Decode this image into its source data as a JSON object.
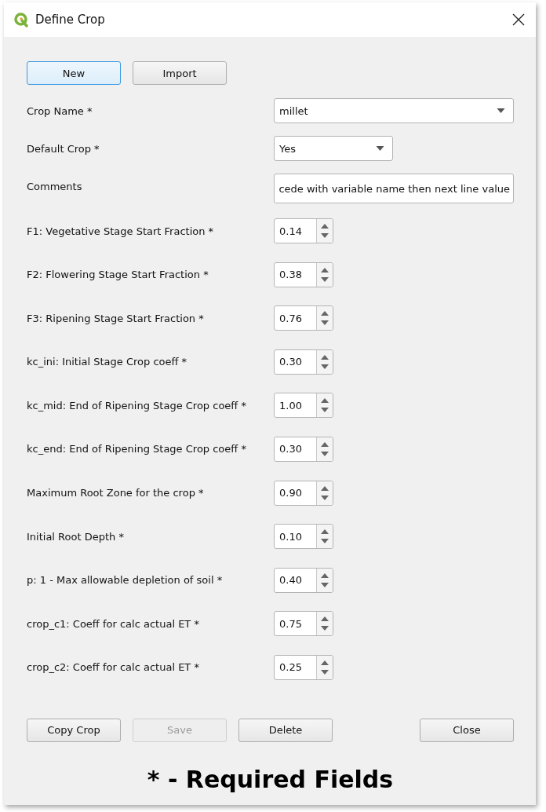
{
  "window": {
    "title": "Define Crop"
  },
  "top_buttons": [
    {
      "label": "New",
      "focused": true,
      "disabled": false
    },
    {
      "label": "Import",
      "focused": false,
      "disabled": false
    }
  ],
  "fields": [
    {
      "kind": "dropdown",
      "label": "Crop Name *",
      "value": "millet",
      "wide": true
    },
    {
      "kind": "dropdown",
      "label": "Default Crop *",
      "value": "Yes",
      "wide": false
    },
    {
      "kind": "text",
      "label": "Comments",
      "value": "cede with variable name then next line value"
    },
    {
      "kind": "spin",
      "label": "F1: Vegetative Stage Start Fraction *",
      "value": "0.14"
    },
    {
      "kind": "spin",
      "label": "F2: Flowering Stage Start Fraction *",
      "value": "0.38"
    },
    {
      "kind": "spin",
      "label": "F3: Ripening Stage Start Fraction *",
      "value": "0.76"
    },
    {
      "kind": "spin",
      "label": "kc_ini: Initial Stage Crop coeff *",
      "value": "0.30"
    },
    {
      "kind": "spin",
      "label": "kc_mid: End of Ripening Stage Crop coeff *",
      "value": "1.00"
    },
    {
      "kind": "spin",
      "label": "kc_end: End of Ripening Stage Crop coeff *",
      "value": "0.30"
    },
    {
      "kind": "spin",
      "label": "Maximum Root Zone for the crop *",
      "value": "0.90"
    },
    {
      "kind": "spin",
      "label": "Initial Root Depth *",
      "value": "0.10"
    },
    {
      "kind": "spin",
      "label": "p: 1 - Max allowable depletion of soil *",
      "value": "0.40"
    },
    {
      "kind": "spin",
      "label": "crop_c1: Coeff for calc actual ET *",
      "value": "0.75"
    },
    {
      "kind": "spin",
      "label": "crop_c2: Coeff for calc actual ET *",
      "value": "0.25"
    }
  ],
  "bottom_buttons": [
    {
      "label": "Copy Crop",
      "disabled": false,
      "focused": false
    },
    {
      "label": "Save",
      "disabled": true,
      "focused": false
    },
    {
      "label": "Delete",
      "disabled": false,
      "focused": false
    },
    {
      "label": "Close",
      "disabled": false,
      "focused": false
    }
  ],
  "footer": "* - Required Fields"
}
